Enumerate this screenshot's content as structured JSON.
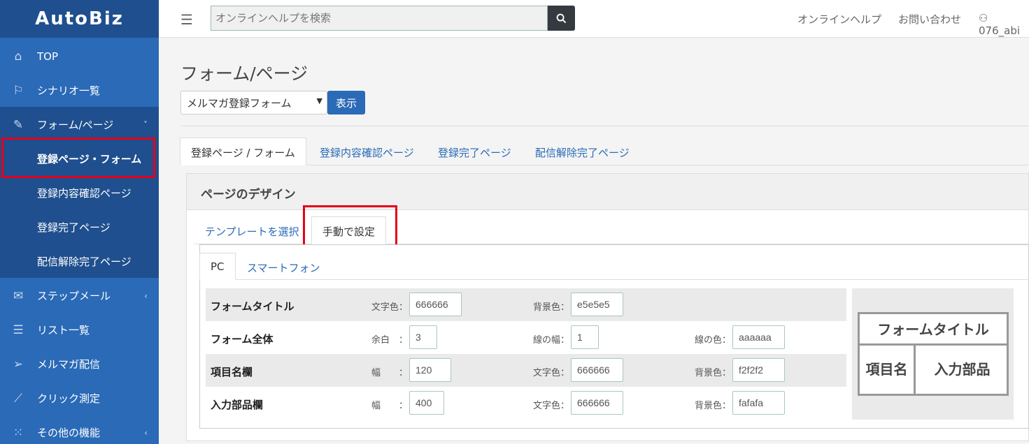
{
  "app": {
    "logo": "AutoBiz"
  },
  "sidebar": {
    "items": [
      {
        "label": "TOP",
        "icon": "home-icon"
      },
      {
        "label": "シナリオ一覧",
        "icon": "flag-icon"
      },
      {
        "label": "フォーム/ページ",
        "icon": "pen-icon",
        "chevron": "˅"
      },
      {
        "label": "ステップメール",
        "icon": "envelope-icon",
        "chevron": "‹"
      },
      {
        "label": "リスト一覧",
        "icon": "list-icon"
      },
      {
        "label": "メルマガ配信",
        "icon": "send-icon"
      },
      {
        "label": "クリック測定",
        "icon": "chart-icon"
      },
      {
        "label": "その他の機能",
        "icon": "grid-icon",
        "chevron": "‹"
      }
    ],
    "sub_items": [
      {
        "label": "登録ページ・フォーム"
      },
      {
        "label": "登録内容確認ページ"
      },
      {
        "label": "登録完了ページ"
      },
      {
        "label": "配信解除完了ページ"
      }
    ]
  },
  "header": {
    "search_placeholder": "オンラインヘルプを検索",
    "help_link": "オンラインヘルプ",
    "contact_link": "お問い合わせ",
    "user": "076_abi"
  },
  "main": {
    "title": "フォーム/ページ",
    "select_value": "メルマガ登録フォーム",
    "show_button": "表示",
    "tabs": [
      {
        "label": "登録ページ / フォーム"
      },
      {
        "label": "登録内容確認ページ"
      },
      {
        "label": "登録完了ページ"
      },
      {
        "label": "配信解除完了ページ"
      }
    ],
    "panel_title": "ページのデザイン",
    "design_tabs": [
      {
        "label": "テンプレートを選択"
      },
      {
        "label": "手動で設定"
      }
    ],
    "device_tabs": [
      {
        "label": "PC"
      },
      {
        "label": "スマートフォン"
      }
    ],
    "rows": [
      {
        "label": "フォームタイトル",
        "fields": [
          {
            "label": "文字色：",
            "value": "666666"
          },
          {
            "label": "背景色：",
            "value": "e5e5e5"
          }
        ]
      },
      {
        "label": "フォーム全体",
        "fields": [
          {
            "label": "余白　：",
            "value": "3"
          },
          {
            "label": "線の幅：",
            "value": "1"
          },
          {
            "label": "線の色：",
            "value": "aaaaaa"
          }
        ]
      },
      {
        "label": "項目名欄",
        "fields": [
          {
            "label": "幅　　：",
            "value": "120"
          },
          {
            "label": "文字色：",
            "value": "666666"
          },
          {
            "label": "背景色：",
            "value": "f2f2f2"
          }
        ]
      },
      {
        "label": "入力部品欄",
        "fields": [
          {
            "label": "幅　　：",
            "value": "400"
          },
          {
            "label": "文字色：",
            "value": "666666"
          },
          {
            "label": "背景色：",
            "value": "fafafa"
          }
        ]
      }
    ],
    "preview": {
      "title": "フォームタイトル",
      "item_name": "項目名",
      "input_part": "入力部品"
    }
  },
  "colors": {
    "sidebar": "#2a6ab7",
    "sidebar_dark": "#1f4f8e",
    "accent_button": "#2a6ab7",
    "highlight_border": "#e3001b"
  }
}
